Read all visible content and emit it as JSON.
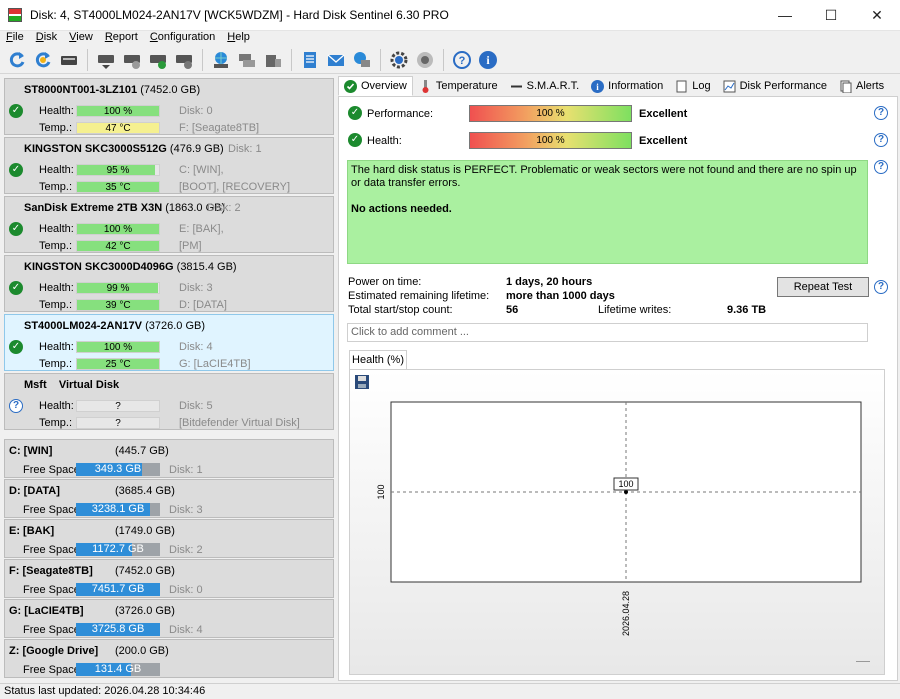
{
  "window": {
    "title": "Disk: 4, ST4000LM024-2AN17V [WCK5WDZM]  -  Hard Disk Sentinel 6.30 PRO",
    "min": "—",
    "max": "☐",
    "close": "✕"
  },
  "menu": [
    {
      "first": "F",
      "rest": "ile"
    },
    {
      "first": "D",
      "rest": "isk"
    },
    {
      "first": "V",
      "rest": "iew"
    },
    {
      "first": "R",
      "rest": "eport"
    },
    {
      "first": "C",
      "rest": "onfiguration"
    },
    {
      "first": "H",
      "rest": "elp"
    }
  ],
  "toolbar_icons": [
    "refresh-icon",
    "refresh-all-icon",
    "disk-icon",
    "disk-eject-icon",
    "disk-test-icon",
    "disk-check-icon",
    "disk-save-icon",
    "network-drive-icon",
    "disk-copy-icon",
    "disk-tools-icon",
    "notes-icon",
    "mail-icon",
    "disk-network-icon",
    "settings-icon",
    "speaker-icon",
    "help-icon",
    "info-icon"
  ],
  "disks": [
    {
      "name": "ST8000NT001-3LZ101",
      "size": "(7452.0 GB)",
      "health_label": "Health:",
      "health": "100 %",
      "health_fill": 1.0,
      "temp_label": "Temp.:",
      "temp": "47 °C",
      "temp_color": "#f5f090",
      "temp_fill": 1.0,
      "disk_line": "Disk: 0",
      "part_line": "F: [Seagate8TB]",
      "status": "ok",
      "selected": false
    },
    {
      "name": "KINGSTON SKC3000S512G",
      "size": "(476.9 GB)",
      "health_label": "Health:",
      "health": "95 %",
      "health_fill": 0.95,
      "temp_label": "Temp.:",
      "temp": "35 °C",
      "temp_color": "#86e07e",
      "temp_fill": 1.0,
      "disk_line": "Disk: 1",
      "part_line": "C: [WIN],",
      "part_line2": "[BOOT],  [RECOVERY]",
      "status": "ok",
      "selected": false
    },
    {
      "name": "SanDisk Extreme 2TB X3N",
      "size": "(1863.0 GB)",
      "health_label": "Health:",
      "health": "100 %",
      "health_fill": 1.0,
      "temp_label": "Temp.:",
      "temp": "42 °C",
      "temp_color": "#86e07e",
      "temp_fill": 1.0,
      "disk_line": "Disk: 2",
      "part_line": "E: [BAK],",
      "part_line2": "[PM]",
      "status": "ok",
      "selected": false
    },
    {
      "name": "KINGSTON SKC3000D4096G",
      "size": "(3815.4 GB)",
      "health_label": "Health:",
      "health": "99 %",
      "health_fill": 0.99,
      "temp_label": "Temp.:",
      "temp": "39 °C",
      "temp_color": "#86e07e",
      "temp_fill": 1.0,
      "disk_line": "Disk: 3",
      "part_line": "D: [DATA]",
      "status": "ok",
      "selected": false
    },
    {
      "name": "ST4000LM024-2AN17V",
      "size": "(3726.0 GB)",
      "health_label": "Health:",
      "health": "100 %",
      "health_fill": 1.0,
      "temp_label": "Temp.:",
      "temp": "25 °C",
      "temp_color": "#86e07e",
      "temp_fill": 1.0,
      "disk_line": "Disk: 4",
      "part_line": "G: [LaCIE4TB]",
      "status": "ok",
      "selected": true
    },
    {
      "name": "Msft    Virtual Disk",
      "size": "",
      "health_label": "Health:",
      "health": "?",
      "health_fill": 0,
      "temp_label": "Temp.:",
      "temp": "?",
      "temp_color": "#e7e7e7",
      "temp_fill": 0,
      "disk_line": "Disk: 5",
      "part_line": "[Bitdefender Virtual Disk]",
      "status": "unknown",
      "selected": false
    }
  ],
  "drives": [
    {
      "name": "C: [WIN]",
      "size": "(445.7 GB)",
      "free_label": "Free Space",
      "free": "349.3 GB",
      "free_fill": 0.78,
      "disk": "Disk: 1"
    },
    {
      "name": "D: [DATA]",
      "size": "(3685.4 GB)",
      "free_label": "Free Space",
      "free": "3238.1 GB",
      "free_fill": 0.88,
      "disk": "Disk: 3"
    },
    {
      "name": "E: [BAK]",
      "size": "(1749.0 GB)",
      "free_label": "Free Space",
      "free": "1172.7 GB",
      "free_fill": 0.67,
      "disk": "Disk: 2"
    },
    {
      "name": "F: [Seagate8TB]",
      "size": "(7452.0 GB)",
      "free_label": "Free Space",
      "free": "7451.7 GB",
      "free_fill": 1.0,
      "disk": "Disk: 0"
    },
    {
      "name": "G: [LaCIE4TB]",
      "size": "(3726.0 GB)",
      "free_label": "Free Space",
      "free": "3725.8 GB",
      "free_fill": 1.0,
      "disk": "Disk: 4"
    },
    {
      "name": "Z: [Google Drive]",
      "size": "(200.0 GB)",
      "free_label": "Free Space",
      "free": "131.4 GB",
      "free_fill": 0.66,
      "disk": ""
    }
  ],
  "tabs": [
    {
      "label": "Overview",
      "icon": "check-icon"
    },
    {
      "label": "Temperature",
      "icon": "thermometer-icon"
    },
    {
      "label": "S.M.A.R.T.",
      "icon": "smart-icon"
    },
    {
      "label": "Information",
      "icon": "info-icon"
    },
    {
      "label": "Log",
      "icon": "log-icon"
    },
    {
      "label": "Disk Performance",
      "icon": "performance-icon"
    },
    {
      "label": "Alerts",
      "icon": "alerts-icon"
    }
  ],
  "overview": {
    "performance_label": "Performance:",
    "performance": "100 %",
    "performance_rating": "Excellent",
    "performance_value": 1.0,
    "health_label": "Health:",
    "health": "100 %",
    "health_rating": "Excellent",
    "health_value": 1.0,
    "status_text": "The hard disk status is PERFECT. Problematic or weak sectors were not found and there are no spin up or data transfer errors.",
    "status_action": "No actions needed.",
    "power_on_label": "Power on time:",
    "power_on": "1 days, 20 hours",
    "lifetime_label": "Estimated remaining lifetime:",
    "lifetime": "more than 1000 days",
    "startstop_label": "Total start/stop count:",
    "startstop": "56",
    "writes_label": "Lifetime writes:",
    "writes": "9.36 TB",
    "repeat_button": "Repeat Test",
    "comment_placeholder": "Click to add comment ...",
    "chart_tab": "Health (%)",
    "colors": {
      "ok": "#1c8a2e",
      "status_bg": "#aaf0a0",
      "selected": "#e0f4ff",
      "free_bar": "#2f8ed8"
    }
  },
  "chart_data": {
    "type": "scatter",
    "x": [
      "2026.04.28"
    ],
    "values": [
      100
    ],
    "ylabel": "",
    "xlabel": "",
    "point_label": "100",
    "ytick": "100",
    "xtick": "2026.04.28",
    "grid": true
  },
  "status_bar": "Status last updated: 2026.04.28 10:34:46"
}
